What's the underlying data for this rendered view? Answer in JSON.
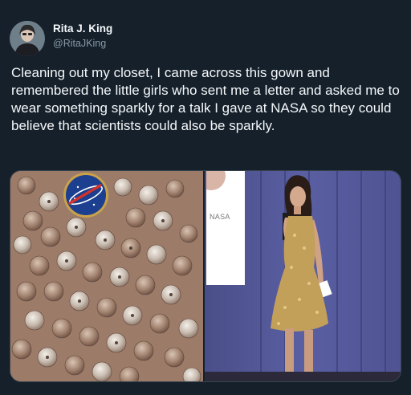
{
  "author": {
    "display_name": "Rita J. King",
    "handle": "@RitaJKing"
  },
  "tweet": {
    "text": "Cleaning out my closet, I came across this gown and remembered the little girls who sent me a letter and asked me to wear something sparkly for a talk I gave at NASA so they could believe that scientists could also be sparkly."
  },
  "media": {
    "left": {
      "subject": "sequined gown fabric with NASA pin"
    },
    "right": {
      "subject": "speaker in gold sequin dress at NASA event",
      "sign_text": "NASA"
    }
  },
  "colors": {
    "background": "#15202b",
    "text_primary": "#f5f8fa",
    "text_secondary": "#8899a6"
  }
}
